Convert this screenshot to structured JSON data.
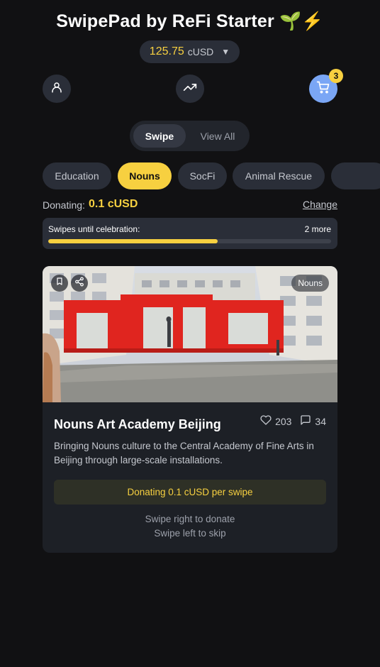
{
  "header": {
    "title": "SwipePad by ReFi Starter 🌱⚡"
  },
  "balance": {
    "amount": "125.75",
    "currency": "cUSD",
    "caret": "▼"
  },
  "nav": {
    "cart_count": "3"
  },
  "view_toggle": {
    "swipe_label": "Swipe",
    "view_all_label": "View All"
  },
  "categories": [
    "Education",
    "Nouns",
    "SocFi",
    "Animal Rescue"
  ],
  "active_category": "Nouns",
  "donation": {
    "label": "Donating:",
    "value": "0.1 cUSD",
    "change_label": "Change"
  },
  "progress": {
    "label": "Swipes until celebration:",
    "remaining": "2 more",
    "fraction": 0.6
  },
  "project": {
    "category_tag": "Nouns",
    "title": "Nouns Art Academy Beijing",
    "likes": "203",
    "comments": "34",
    "description": "Bringing Nouns culture to the Central Academy of Fine Arts in Beijing through large-scale installations.",
    "donate_text": "Donating 0.1 cUSD per swipe",
    "hint_right": "Swipe right to donate",
    "hint_left": "Swipe left to skip"
  },
  "colors": {
    "accent": "#f7d040",
    "background": "#111113",
    "surface": "#2a2e38",
    "cart": "#7aa6f5",
    "sculpture_red": "#e0251f"
  },
  "icons": [
    "user-icon",
    "trending-up-icon",
    "cart-icon",
    "bookmark-icon",
    "share-icon",
    "heart-icon",
    "comment-icon"
  ]
}
